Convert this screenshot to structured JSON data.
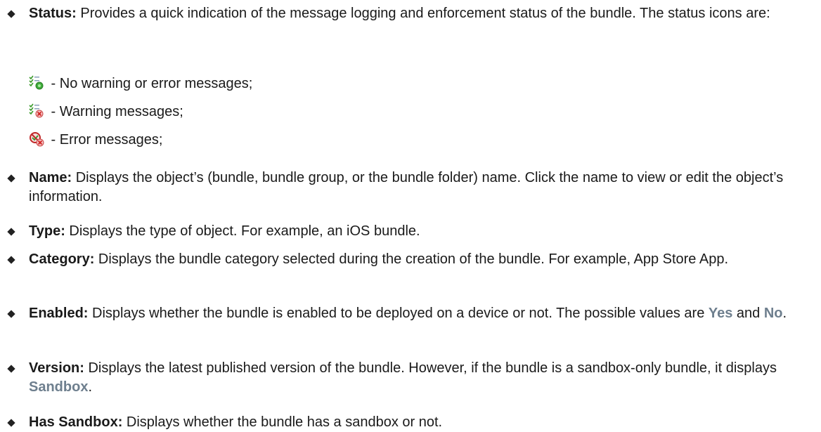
{
  "items": [
    {
      "term": "Status:",
      "text": " Provides a quick indication of the message logging and enforcement status of the bundle. The status icons are:"
    },
    {
      "term": "Name:",
      "text": " Displays the object’s (bundle, bundle group, or the bundle folder) name. Click the name to view or edit the object’s information."
    },
    {
      "term": "Type:",
      "text": " Displays the type of object. For example, an iOS bundle."
    },
    {
      "term": "Category:",
      "text": " Displays the bundle category selected during the creation of the bundle. For example, App Store App."
    },
    {
      "term": "Enabled:",
      "text_a": " Displays whether the bundle is enabled to be deployed on a device or not. The possible values are ",
      "value_1": "Yes",
      "text_b": " and ",
      "value_2": "No",
      "text_c": "."
    },
    {
      "term": "Version:",
      "text_a": " Displays the latest published version of the bundle. However, if the bundle is a sandbox-only bundle, it displays ",
      "value_1": "Sandbox",
      "text_b": "."
    },
    {
      "term": "Has Sandbox:",
      "text": " Displays whether the bundle has a sandbox or not."
    }
  ],
  "status_icons": [
    {
      "icon": "no-warning-status-icon",
      "label": " - No warning or error messages;"
    },
    {
      "icon": "warning-status-icon",
      "label": " - Warning messages;"
    },
    {
      "icon": "error-status-icon",
      "label": " - Error messages;"
    }
  ]
}
